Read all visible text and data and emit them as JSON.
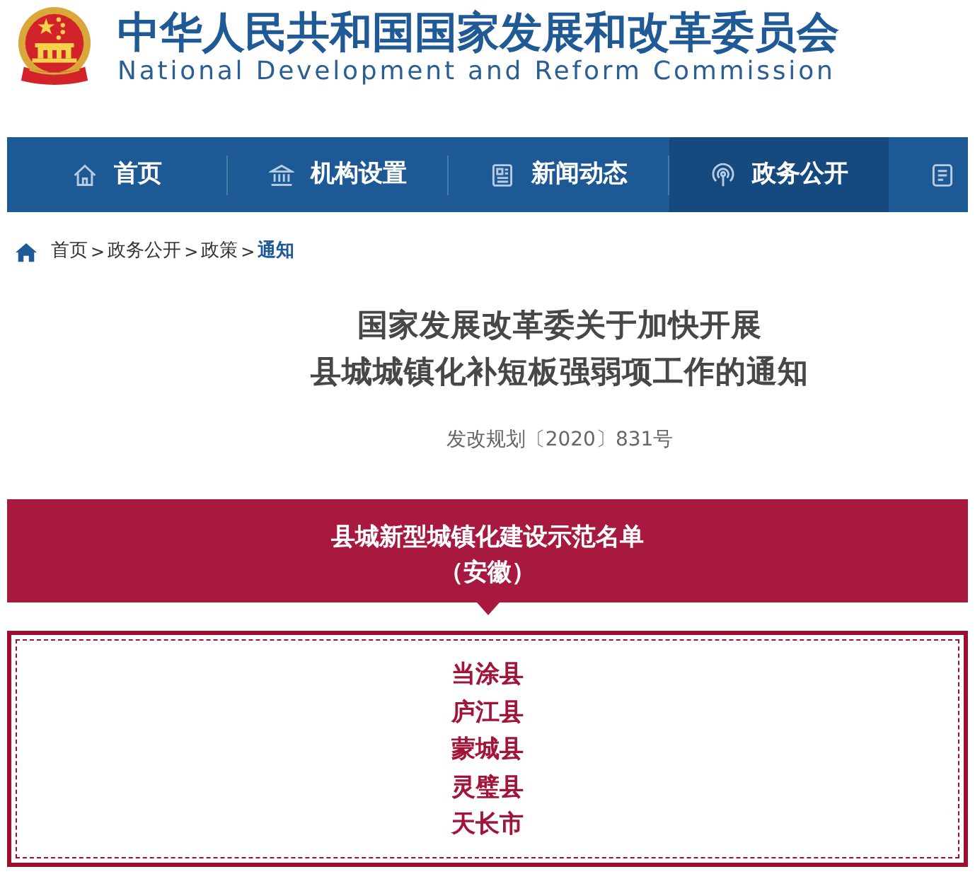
{
  "header": {
    "title": "中华人民共和国国家发展和改革委员会",
    "subtitle": "National Development and Reform Commission"
  },
  "nav": [
    {
      "label": "首页",
      "selected": false
    },
    {
      "label": "机构设置",
      "selected": false
    },
    {
      "label": "新闻动态",
      "selected": false
    },
    {
      "label": "政务公开",
      "selected": true
    },
    {
      "selected": false
    }
  ],
  "breadcrumb": [
    {
      "kind": "link",
      "label": "首页",
      "current": false
    },
    {
      "kind": "separator",
      "label": ">"
    },
    {
      "kind": "link",
      "label": "政务公开",
      "current": false
    },
    {
      "kind": "separator",
      "label": ">"
    },
    {
      "kind": "link",
      "label": "政策",
      "current": false
    },
    {
      "kind": "separator",
      "label": ">"
    },
    {
      "kind": "link",
      "label": "通知",
      "current": true
    }
  ],
  "article": {
    "title": [
      "国家发展改革委关于加快开展",
      "县城城镇化补短板强弱项工作的通知"
    ],
    "doc_number": "发改规划〔2020〕831号"
  },
  "banner": {
    "title": "县城新型城镇化建设示范名单",
    "subtitle": "（安徽）"
  },
  "counties": [
    "当涂县",
    "庐江县",
    "蒙城县",
    "灵璧县",
    "天长市"
  ]
}
